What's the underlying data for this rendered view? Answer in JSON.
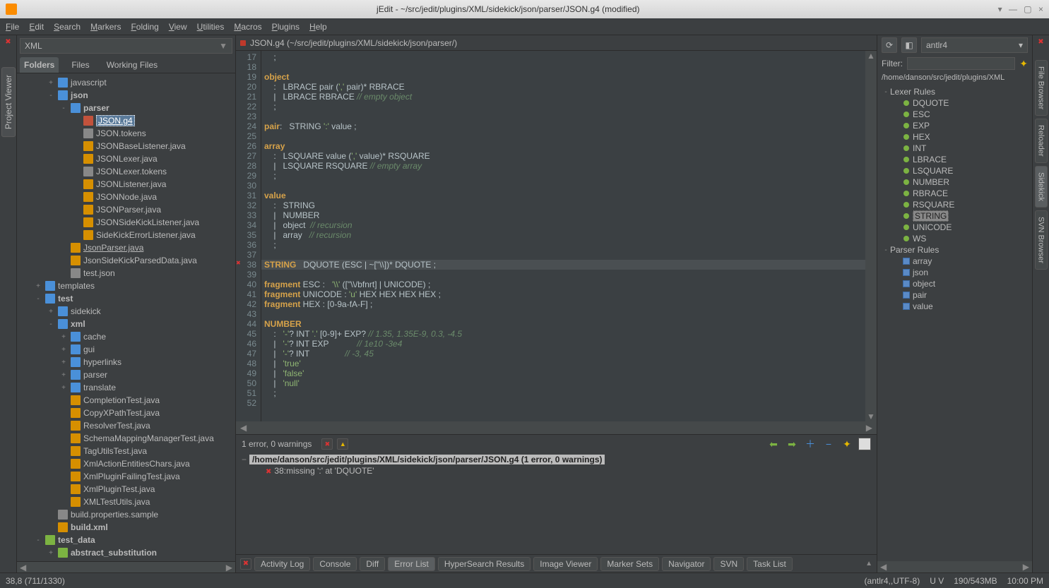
{
  "titlebar": {
    "title": "jEdit - ~/src/jedit/plugins/XML/sidekick/json/parser/JSON.g4 (modified)"
  },
  "menu": [
    "File",
    "Edit",
    "Search",
    "Markers",
    "Folding",
    "View",
    "Utilities",
    "Macros",
    "Plugins",
    "Help"
  ],
  "leftCombo": "XML",
  "leftRailTab": "Project Viewer",
  "projectTabs": {
    "items": [
      "Folders",
      "Files",
      "Working Files"
    ],
    "active": 0
  },
  "tree": [
    {
      "d": 2,
      "tw": "+",
      "ic": "folder",
      "lbl": "javascript"
    },
    {
      "d": 2,
      "tw": "-",
      "ic": "folder",
      "lbl": "json",
      "bold": true
    },
    {
      "d": 3,
      "tw": "-",
      "ic": "folder",
      "lbl": "parser",
      "bold": true
    },
    {
      "d": 4,
      "tw": "",
      "ic": "file-x",
      "lbl": "JSON.g4",
      "sel": true,
      "ul": true
    },
    {
      "d": 4,
      "tw": "",
      "ic": "file",
      "lbl": "JSON.tokens"
    },
    {
      "d": 4,
      "tw": "",
      "ic": "file-j",
      "lbl": "JSONBaseListener.java"
    },
    {
      "d": 4,
      "tw": "",
      "ic": "file-j",
      "lbl": "JSONLexer.java"
    },
    {
      "d": 4,
      "tw": "",
      "ic": "file",
      "lbl": "JSONLexer.tokens"
    },
    {
      "d": 4,
      "tw": "",
      "ic": "file-j",
      "lbl": "JSONListener.java"
    },
    {
      "d": 4,
      "tw": "",
      "ic": "file-j",
      "lbl": "JSONNode.java"
    },
    {
      "d": 4,
      "tw": "",
      "ic": "file-j",
      "lbl": "JSONParser.java"
    },
    {
      "d": 4,
      "tw": "",
      "ic": "file-j",
      "lbl": "JSONSideKickListener.java"
    },
    {
      "d": 4,
      "tw": "",
      "ic": "file-j",
      "lbl": "SideKickErrorListener.java"
    },
    {
      "d": 3,
      "tw": "",
      "ic": "file-j",
      "lbl": "JsonParser.java",
      "ul": true
    },
    {
      "d": 3,
      "tw": "",
      "ic": "file-j",
      "lbl": "JsonSideKickParsedData.java"
    },
    {
      "d": 3,
      "tw": "",
      "ic": "file",
      "lbl": "test.json"
    },
    {
      "d": 1,
      "tw": "+",
      "ic": "folder",
      "lbl": "templates"
    },
    {
      "d": 1,
      "tw": "-",
      "ic": "folder",
      "lbl": "test",
      "bold": true
    },
    {
      "d": 2,
      "tw": "+",
      "ic": "folder",
      "lbl": "sidekick"
    },
    {
      "d": 2,
      "tw": "-",
      "ic": "folder",
      "lbl": "xml",
      "bold": true
    },
    {
      "d": 3,
      "tw": "+",
      "ic": "folder",
      "lbl": "cache"
    },
    {
      "d": 3,
      "tw": "+",
      "ic": "folder",
      "lbl": "gui"
    },
    {
      "d": 3,
      "tw": "+",
      "ic": "folder",
      "lbl": "hyperlinks"
    },
    {
      "d": 3,
      "tw": "+",
      "ic": "folder",
      "lbl": "parser"
    },
    {
      "d": 3,
      "tw": "+",
      "ic": "folder",
      "lbl": "translate"
    },
    {
      "d": 3,
      "tw": "",
      "ic": "file-j",
      "lbl": "CompletionTest.java"
    },
    {
      "d": 3,
      "tw": "",
      "ic": "file-j",
      "lbl": "CopyXPathTest.java"
    },
    {
      "d": 3,
      "tw": "",
      "ic": "file-j",
      "lbl": "ResolverTest.java"
    },
    {
      "d": 3,
      "tw": "",
      "ic": "file-j",
      "lbl": "SchemaMappingManagerTest.java"
    },
    {
      "d": 3,
      "tw": "",
      "ic": "file-j",
      "lbl": "TagUtilsTest.java"
    },
    {
      "d": 3,
      "tw": "",
      "ic": "file-j",
      "lbl": "XmlActionEntitiesChars.java"
    },
    {
      "d": 3,
      "tw": "",
      "ic": "file-j",
      "lbl": "XmlPluginFailingTest.java"
    },
    {
      "d": 3,
      "tw": "",
      "ic": "file-j",
      "lbl": "XmlPluginTest.java"
    },
    {
      "d": 3,
      "tw": "",
      "ic": "file-j",
      "lbl": "XMLTestUtils.java"
    },
    {
      "d": 2,
      "tw": "",
      "ic": "file",
      "lbl": "build.properties.sample"
    },
    {
      "d": 2,
      "tw": "",
      "ic": "file-j",
      "lbl": "build.xml",
      "bold": true
    },
    {
      "d": 1,
      "tw": "-",
      "ic": "folder-g",
      "lbl": "test_data",
      "bold": true
    },
    {
      "d": 2,
      "tw": "+",
      "ic": "folder-g",
      "lbl": "abstract_substitution",
      "bold": true
    }
  ],
  "bufferTab": "JSON.g4 (~/src/jedit/plugins/XML/sidekick/json/parser/)",
  "code": {
    "start": 17,
    "lines": [
      "    ;",
      "",
      "object",
      "    :   LBRACE pair (',' pair)* RBRACE",
      "    |   LBRACE RBRACE // empty object",
      "    ;",
      "",
      "pair:   STRING ':' value ;",
      "",
      "array",
      "    :   LSQUARE value (',' value)* RSQUARE",
      "    |   LSQUARE RSQUARE // empty array",
      "    ;",
      "",
      "value",
      "    :   STRING",
      "    |   NUMBER",
      "    |   object  // recursion",
      "    |   array   // recursion",
      "    ;",
      "",
      "STRING   DQUOTE (ESC | ~[\"\\\\])* DQUOTE ;",
      "",
      "fragment ESC :   '\\\\' ([\"\\\\/bfnrt] | UNICODE) ;",
      "fragment UNICODE : 'u' HEX HEX HEX HEX ;",
      "fragment HEX : [0-9a-fA-F] ;",
      "",
      "NUMBER",
      "    :   '-'? INT '.' [0-9]+ EXP? // 1.35, 1.35E-9, 0.3, -4.5",
      "    |   '-'? INT EXP            // 1e10 -3e4",
      "    |   '-'? INT               // -3, 45",
      "    |   'true'",
      "    |   'false'",
      "    |   'null'",
      "    ;",
      ""
    ],
    "highlight_line": 38,
    "error_line": 38
  },
  "errors": {
    "summary": "1 error, 0 warnings",
    "file": "/home/danson/src/jedit/plugins/XML/sidekick/json/parser/JSON.g4 (1 error, 0 warnings)",
    "items": [
      "38:missing ':' at 'DQUOTE'"
    ]
  },
  "dockTabs": {
    "items": [
      "Activity Log",
      "Console",
      "Diff",
      "Error List",
      "HyperSearch Results",
      "Image Viewer",
      "Marker Sets",
      "Navigator",
      "SVN",
      "Task List"
    ],
    "active": 3
  },
  "rightPanel": {
    "parser": "antlr4",
    "filterLabel": "Filter:",
    "path": "/home/danson/src/jedit/plugins/XML",
    "lexerLabel": "Lexer Rules",
    "lexer": [
      "DQUOTE",
      "ESC",
      "EXP",
      "HEX",
      "INT",
      "LBRACE",
      "LSQUARE",
      "NUMBER",
      "RBRACE",
      "RSQUARE",
      "STRING",
      "UNICODE",
      "WS"
    ],
    "lexerSelected": "STRING",
    "parserLabel": "Parser Rules",
    "parserRules": [
      "array",
      "json",
      "object",
      "pair",
      "value"
    ]
  },
  "rightRail": [
    "File Browser",
    "Reloader",
    "Sidekick",
    "SVN Browser"
  ],
  "status": {
    "left": "38,8 (711/1330)",
    "mode": "(antlr4,,UTF-8)",
    "uv": "U V",
    "mem": "190/543MB",
    "time": "10:00 PM"
  }
}
